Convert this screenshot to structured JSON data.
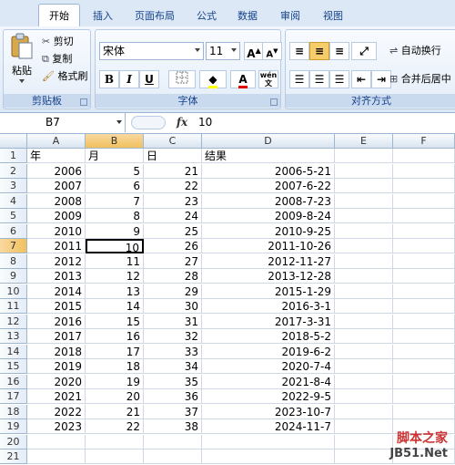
{
  "tabs": [
    "开始",
    "插入",
    "页面布局",
    "公式",
    "数据",
    "审阅",
    "视图"
  ],
  "clipboard": {
    "paste": "粘贴",
    "cut": "剪切",
    "copy": "复制",
    "format_painter": "格式刷",
    "label": "剪贴板"
  },
  "font": {
    "name": "宋体",
    "size": "11",
    "label": "字体",
    "bold": "B",
    "italic": "I",
    "underline": "U",
    "grow": "A",
    "shrink": "A",
    "phonetic": "wén",
    "phonetic_char": "文"
  },
  "alignment": {
    "wrap": "自动换行",
    "merge": "合并后居中",
    "label": "对齐方式"
  },
  "formula_bar": {
    "name_box": "B7",
    "fx": "fx",
    "value": "10"
  },
  "columns": [
    "A",
    "B",
    "C",
    "D",
    "E",
    "F"
  ],
  "active_cell": "B7",
  "rows": [
    [
      "年",
      "月",
      "日",
      "结果"
    ],
    [
      "2006",
      "5",
      "21",
      "2006-5-21"
    ],
    [
      "2007",
      "6",
      "22",
      "2007-6-22"
    ],
    [
      "2008",
      "7",
      "23",
      "2008-7-23"
    ],
    [
      "2009",
      "8",
      "24",
      "2009-8-24"
    ],
    [
      "2010",
      "9",
      "25",
      "2010-9-25"
    ],
    [
      "2011",
      "10",
      "26",
      "2011-10-26"
    ],
    [
      "2012",
      "11",
      "27",
      "2012-11-27"
    ],
    [
      "2013",
      "12",
      "28",
      "2013-12-28"
    ],
    [
      "2014",
      "13",
      "29",
      "2015-1-29"
    ],
    [
      "2015",
      "14",
      "30",
      "2016-3-1"
    ],
    [
      "2016",
      "15",
      "31",
      "2017-3-31"
    ],
    [
      "2017",
      "16",
      "32",
      "2018-5-2"
    ],
    [
      "2018",
      "17",
      "33",
      "2019-6-2"
    ],
    [
      "2019",
      "18",
      "34",
      "2020-7-4"
    ],
    [
      "2020",
      "19",
      "35",
      "2021-8-4"
    ],
    [
      "2021",
      "20",
      "36",
      "2022-9-5"
    ],
    [
      "2022",
      "21",
      "37",
      "2023-10-7"
    ],
    [
      "2023",
      "22",
      "38",
      "2024-11-7"
    ],
    [
      "",
      "",
      "",
      ""
    ],
    [
      "",
      "",
      "",
      ""
    ],
    [
      "",
      "",
      "",
      ""
    ]
  ],
  "watermark": {
    "line1": "脚本之家",
    "line2": "JB51.Net"
  }
}
